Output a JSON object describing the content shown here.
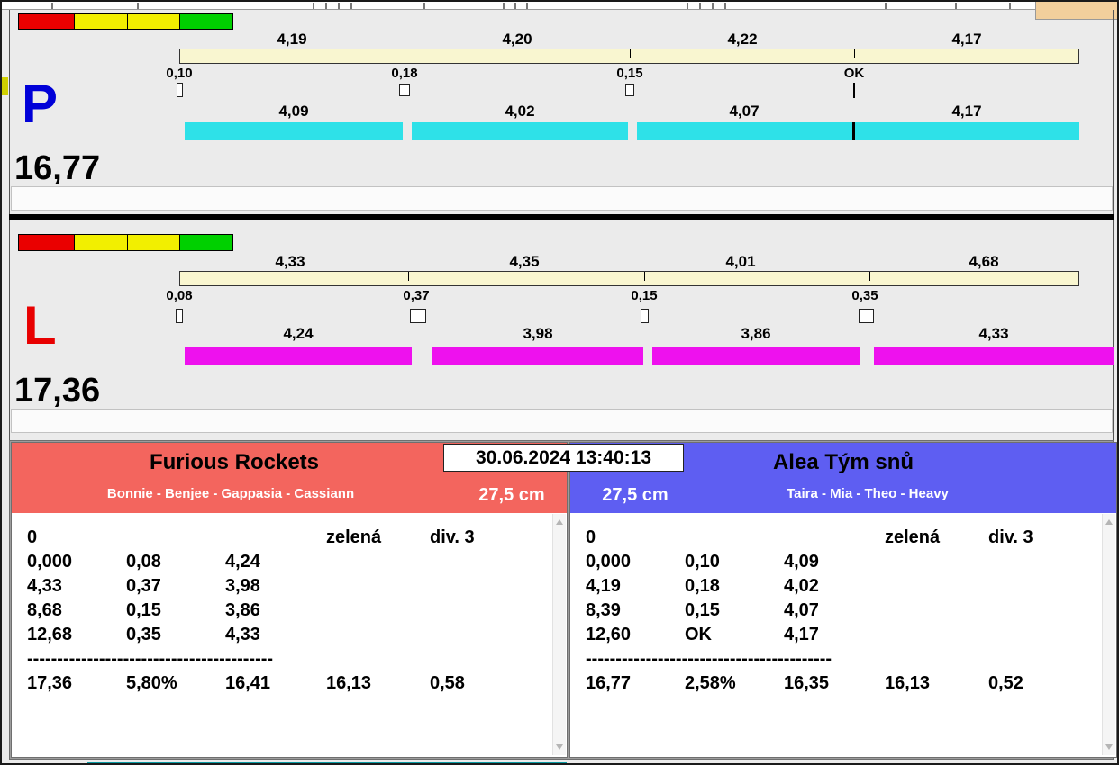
{
  "app": {
    "datetime": "30.06.2024 13:40:13",
    "separator": "-----------------------------------------"
  },
  "colors": {
    "lane_p_bar": "#2ee1e8",
    "lane_l_bar": "#ee11ee",
    "lane_p_letter": "#0000d8",
    "lane_l_letter": "#e80000",
    "team_left_header": "#f3655e",
    "team_right_header": "#5e5ef2",
    "traffic_lights": [
      "#ea0000",
      "#f2ef00",
      "#f2ef00",
      "#00d000"
    ]
  },
  "lanes": [
    {
      "id": "P",
      "letter": "P",
      "total": "16,77",
      "split_times": [
        "4,19",
        "4,20",
        "4,22",
        "4,17"
      ],
      "change_times": [
        "0,10",
        "0,18",
        "0,15",
        "OK"
      ],
      "run_times": [
        "4,09",
        "4,02",
        "4,07",
        "4,17"
      ]
    },
    {
      "id": "L",
      "letter": "L",
      "total": "17,36",
      "split_times": [
        "4,33",
        "4,35",
        "4,01",
        "4,68"
      ],
      "change_times": [
        "0,08",
        "0,37",
        "0,15",
        "0,35"
      ],
      "run_times": [
        "4,24",
        "3,98",
        "3,86",
        "4,33"
      ]
    }
  ],
  "teams": [
    {
      "name": "Furious Rockets",
      "members": "Bonnie - Benjee - Gappasia - Cassiann",
      "jump_height": "27,5 cm",
      "info_row": {
        "col1": "0",
        "col4": "zelená",
        "col5": "div. 3"
      },
      "rows": [
        [
          "0,000",
          "0,08",
          "4,24"
        ],
        [
          "4,33",
          "0,37",
          "3,98"
        ],
        [
          "8,68",
          "0,15",
          "3,86"
        ],
        [
          "12,68",
          "0,35",
          "4,33"
        ]
      ],
      "totals": [
        "17,36",
        "5,80%",
        "16,41",
        "16,13",
        "0,58"
      ]
    },
    {
      "name": "Alea Tým snů",
      "members": "Taira - Mia - Theo - Heavy",
      "jump_height": "27,5 cm",
      "info_row": {
        "col1": "0",
        "col4": "zelená",
        "col5": "div. 3"
      },
      "rows": [
        [
          "0,000",
          "0,10",
          "4,09"
        ],
        [
          "4,19",
          "0,18",
          "4,02"
        ],
        [
          "8,39",
          "0,15",
          "4,07"
        ],
        [
          "12,60",
          "OK",
          "4,17"
        ]
      ],
      "totals": [
        "16,77",
        "2,58%",
        "16,35",
        "16,13",
        "0,52"
      ]
    }
  ]
}
